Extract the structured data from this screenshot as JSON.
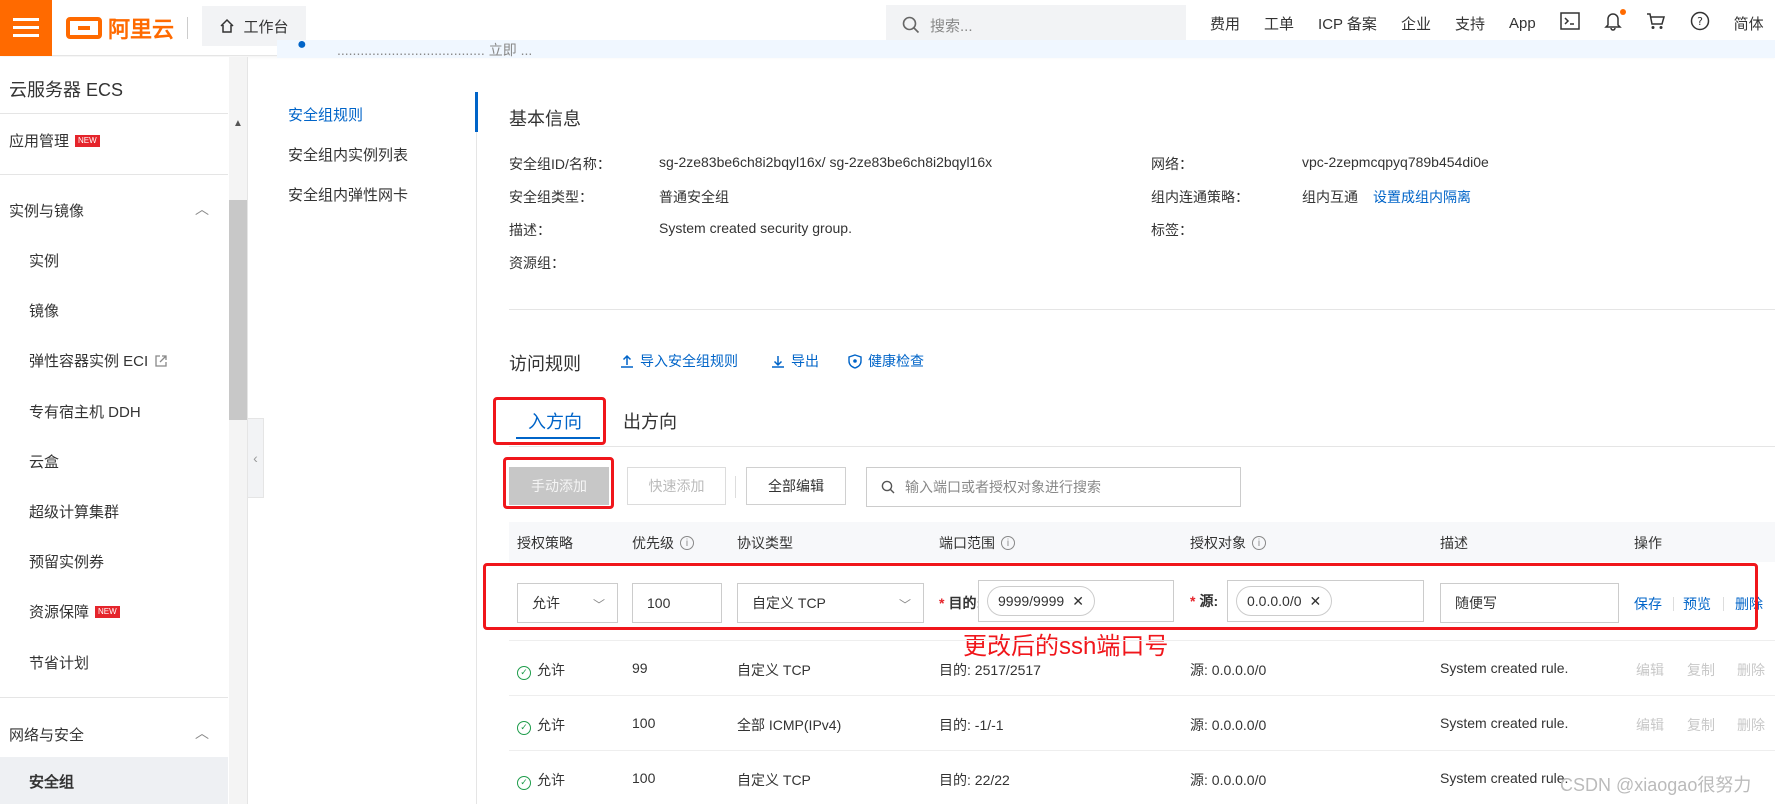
{
  "topbar": {
    "logo_text": "阿里云",
    "workbench": "工作台",
    "search_placeholder": "搜索...",
    "nav": [
      "费用",
      "工单",
      "ICP 备案",
      "企业",
      "支持",
      "App"
    ],
    "lang": "简体"
  },
  "banner": {
    "text": "...................................... 立即 ..."
  },
  "sidebar": {
    "title": "云服务器 ECS",
    "app_mgmt": "应用管理",
    "new_badge": "NEW",
    "group1": "实例与镜像",
    "items1": [
      "实例",
      "镜像",
      "弹性容器实例 ECI",
      "专有宿主机 DDH",
      "云盒",
      "超级计算集群",
      "预留实例券",
      "资源保障",
      "节省计划"
    ],
    "group2": "网络与安全",
    "active_item": "安全组"
  },
  "secnav": [
    "安全组规则",
    "安全组内实例列表",
    "安全组内弹性网卡"
  ],
  "basic": {
    "title": "基本信息",
    "id_label": "安全组ID/名称：",
    "id_value": "sg-2ze83be6ch8i2bqyl16x/ sg-2ze83be6ch8i2bqyl16x",
    "type_label": "安全组类型：",
    "type_value": "普通安全组",
    "desc_label": "描述：",
    "desc_value": "System created security group.",
    "rg_label": "资源组：",
    "net_label": "网络：",
    "net_value": "vpc-2zepmcqpyq789b454di0e",
    "policy_label": "组内连通策略：",
    "policy_value": "组内互通",
    "policy_link": "设置成组内隔离",
    "tag_label": "标签："
  },
  "rules": {
    "title": "访问规则",
    "import": "导入安全组规则",
    "export": "导出",
    "health": "健康检查",
    "tab_in": "入方向",
    "tab_out": "出方向",
    "btn_manual": "手动添加",
    "btn_quick": "快速添加",
    "btn_edit_all": "全部编辑",
    "search_placeholder": "输入端口或者授权对象进行搜索"
  },
  "table": {
    "headers": [
      "授权策略",
      "优先级",
      "协议类型",
      "端口范围",
      "授权对象",
      "描述",
      "操作"
    ],
    "edit_row": {
      "policy": "允许",
      "priority": "100",
      "protocol": "自定义 TCP",
      "dest_label": "目的:",
      "port": "9999/9999",
      "src_label": "源:",
      "source": "0.0.0.0/0",
      "desc": "随便写",
      "save": "保存",
      "preview": "预览",
      "delete": "删除"
    },
    "rows": [
      {
        "policy": "允许",
        "priority": "99",
        "protocol": "自定义 TCP",
        "port": "目的: 2517/2517",
        "source": "源: 0.0.0.0/0",
        "desc": "System created rule."
      },
      {
        "policy": "允许",
        "priority": "100",
        "protocol": "全部 ICMP(IPv4)",
        "port": "目的: -1/-1",
        "source": "源: 0.0.0.0/0",
        "desc": "System created rule."
      },
      {
        "policy": "允许",
        "priority": "100",
        "protocol": "自定义 TCP",
        "port": "目的: 22/22",
        "source": "源: 0.0.0.0/0",
        "desc": "System created rule."
      }
    ],
    "row_actions": [
      "编辑",
      "复制",
      "删除"
    ]
  },
  "annotation": "更改后的ssh端口号",
  "watermark": "CSDN @xiaogao很努力",
  "colors": {
    "brand": "#ff6a00",
    "link": "#0064c8",
    "annotation_red": "#f0161b"
  }
}
